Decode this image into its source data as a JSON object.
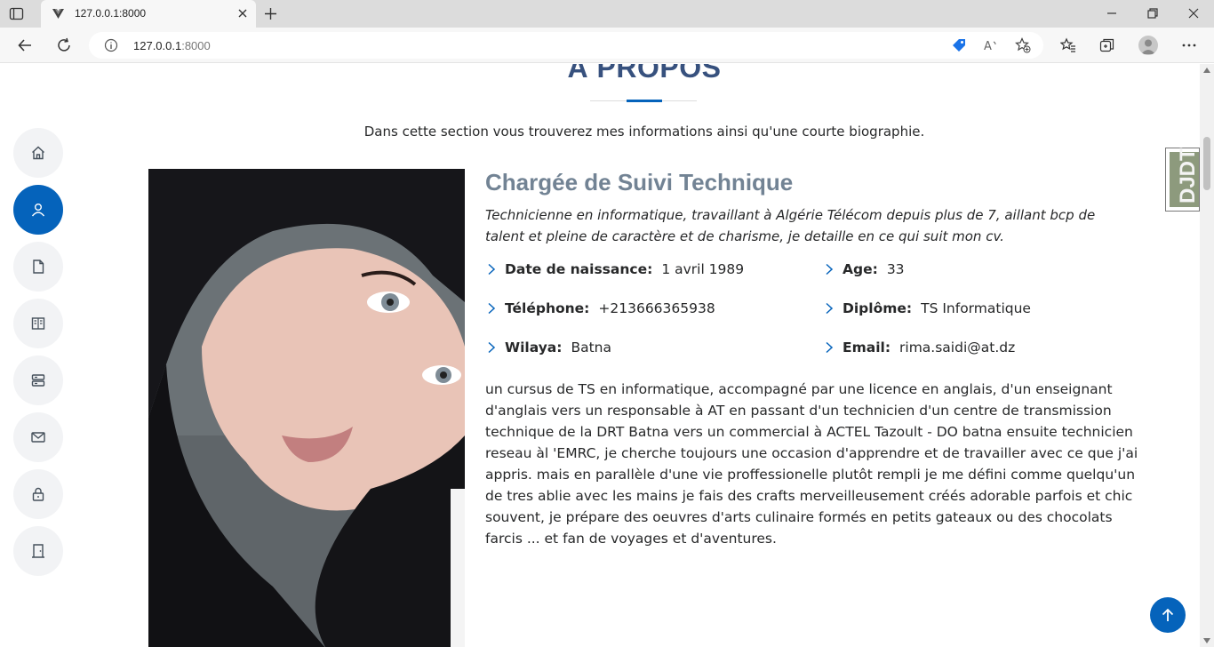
{
  "browser": {
    "tab_title": "127.0.0.1:8000",
    "url_host": "127.0.0.1",
    "url_port": ":8000"
  },
  "section": {
    "title": "À PROPOS",
    "description": "Dans cette section vous trouverez mes informations ainsi qu'une courte biographie."
  },
  "nav": {
    "items": [
      {
        "name": "home-icon",
        "active": false
      },
      {
        "name": "user-icon",
        "active": true
      },
      {
        "name": "file-icon",
        "active": false
      },
      {
        "name": "book-icon",
        "active": false
      },
      {
        "name": "server-icon",
        "active": false
      },
      {
        "name": "envelope-icon",
        "active": false
      },
      {
        "name": "lock-icon",
        "active": false
      },
      {
        "name": "door-icon",
        "active": false
      }
    ]
  },
  "profile": {
    "job_title": "Chargée de Suivi Technique",
    "intro": "Technicienne en informatique, travaillant à Algérie Télécom depuis plus de 7, aillant bcp de talent et pleine de caractère et de charisme, je detaille en ce qui suit mon cv.",
    "info": {
      "birth_label": "Date de naissance:",
      "birth_value": "1 avril 1989",
      "age_label": "Age:",
      "age_value": "33",
      "phone_label": "Téléphone:",
      "phone_value": "+213666365938",
      "diploma_label": "Diplôme:",
      "diploma_value": "TS Informatique",
      "wilaya_label": "Wilaya:",
      "wilaya_value": "Batna",
      "email_label": "Email:",
      "email_value": "rima.saidi@at.dz"
    },
    "bio": "un cursus de TS en informatique, accompagné par une licence en anglais, d'un enseignant d'anglais vers un responsable à AT en passant d'un technicien d'un centre de transmission technique de la DRT Batna vers un commercial à ACTEL Tazoult - DO batna ensuite technicien reseau àl 'EMRC, je cherche toujours une occasion d'apprendre et de travailler avec ce que j'ai appris. mais en parallèle d'une vie proffessionelle plutôt rempli je me défini comme quelqu'un de tres ablie avec les mains je fais des crafts merveilleusement créés adorable parfois et chic souvent, je prépare des oeuvres d'arts culinaire formés en petits gateaux ou des chocolats farcis ... et fan de voyages et d'aventures."
  },
  "badge": {
    "text": "DJDT"
  },
  "colors": {
    "accent": "#0563bb",
    "heading": "#37517e",
    "job_title": "#728394",
    "text": "#272829"
  }
}
